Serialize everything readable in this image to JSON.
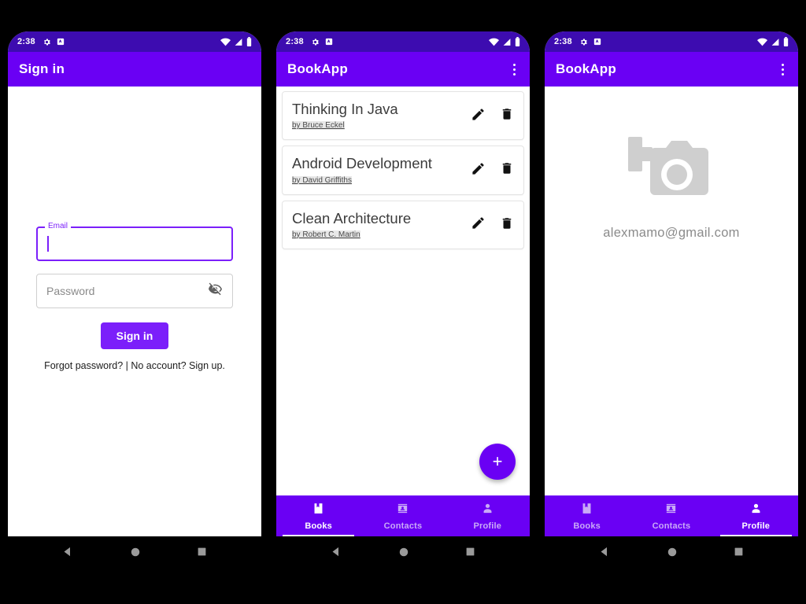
{
  "theme": {
    "primary": "#6a00f4",
    "primary_dark": "#3d0cb0",
    "accent": "#7b1ffa",
    "inactive_nav": "#c9aaf7",
    "background": "#000000",
    "screen_background": "#ffffff"
  },
  "status_bar": {
    "time": "2:38",
    "left_icons": [
      "gear-icon",
      "app-badge-icon"
    ],
    "right_icons": [
      "wifi-icon",
      "signal-icon",
      "battery-icon"
    ]
  },
  "system_nav": {
    "back": "back-triangle",
    "home": "home-circle",
    "recents": "recents-square"
  },
  "phones": {
    "signin": {
      "appbar_title": "Sign in",
      "email_field": {
        "label": "Email",
        "value": "",
        "placeholder": ""
      },
      "password_field": {
        "placeholder": "Password",
        "value": "",
        "toggle_icon": "eye-off-icon"
      },
      "submit_button": "Sign in",
      "footer_text": "Forgot password? | No account? Sign up.",
      "footer_forgot": "Forgot password?",
      "footer_separator": " | ",
      "footer_signup": "No account? Sign up."
    },
    "books": {
      "appbar_title": "BookApp",
      "overflow_menu": "more-options",
      "items": [
        {
          "title": "Thinking In Java",
          "author": "by Bruce Eckel",
          "edit": "edit-icon",
          "delete": "delete-icon"
        },
        {
          "title": "Android Development",
          "author": "by David Griffiths",
          "edit": "edit-icon",
          "delete": "delete-icon"
        },
        {
          "title": "Clean Architecture",
          "author": "by Robert C. Martin",
          "edit": "edit-icon",
          "delete": "delete-icon"
        }
      ],
      "fab_label": "+",
      "bottom_nav": {
        "active": "Books",
        "items": [
          {
            "label": "Books",
            "icon": "book-icon"
          },
          {
            "label": "Contacts",
            "icon": "contacts-icon"
          },
          {
            "label": "Profile",
            "icon": "person-icon"
          }
        ]
      }
    },
    "profile": {
      "appbar_title": "BookApp",
      "overflow_menu": "more-options",
      "avatar_icon": "add-a-photo-icon",
      "email": "alexmamo@gmail.com",
      "bottom_nav": {
        "active": "Profile",
        "items": [
          {
            "label": "Books",
            "icon": "book-icon"
          },
          {
            "label": "Contacts",
            "icon": "contacts-icon"
          },
          {
            "label": "Profile",
            "icon": "person-icon"
          }
        ]
      }
    }
  }
}
